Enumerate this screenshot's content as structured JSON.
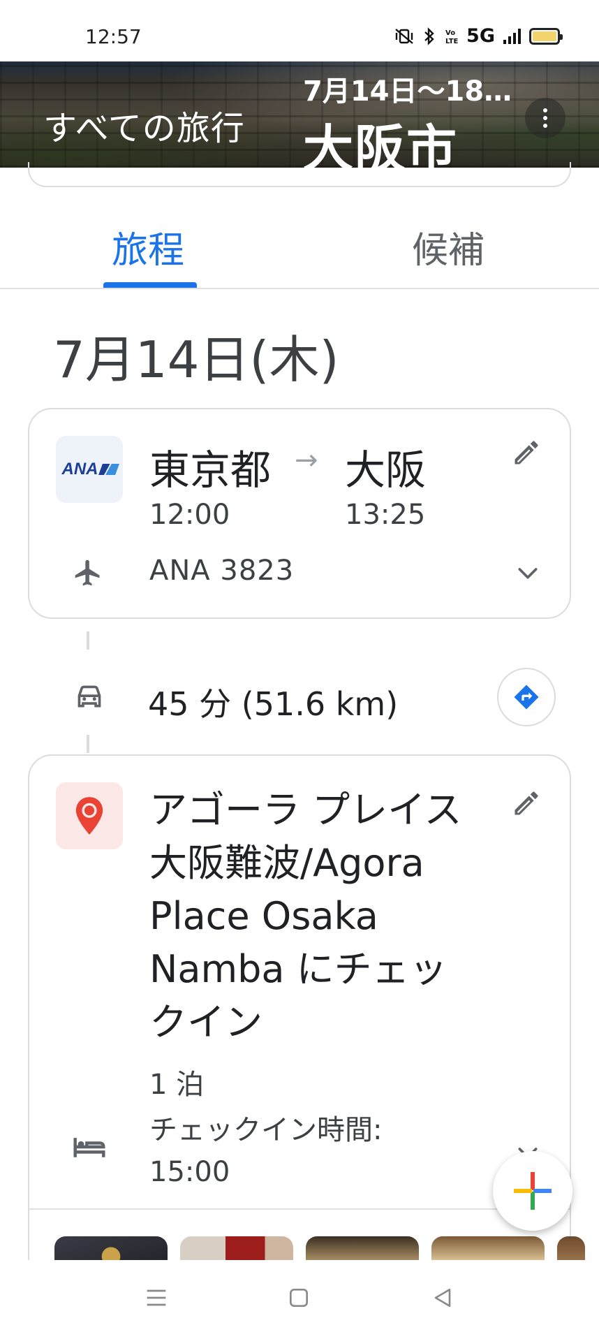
{
  "status_bar": {
    "time": "12:57",
    "network": "5G"
  },
  "header": {
    "back_label": "すべての旅行",
    "dates": "7月14日～18…",
    "city": "大阪市"
  },
  "tabs": [
    {
      "label": "旅程",
      "selected": true
    },
    {
      "label": "候補",
      "selected": false
    }
  ],
  "day": {
    "date": "7月14日(木)"
  },
  "flight": {
    "airline_logo_text": "ANA",
    "from": "東京都",
    "arrow": "→",
    "to": "大阪",
    "departure_time": "12:00",
    "arrival_time": "13:25",
    "flight_number": "ANA 3823"
  },
  "drive": {
    "text": "45 分 (51.6 km)"
  },
  "hotel": {
    "name": "アゴーラ プレイス 大阪難波/Agora Place Osaka Namba にチェックイン",
    "nights": "1 泊",
    "checkin_time_label": "チェックイン時間: 15:00"
  },
  "colors": {
    "accent": "#1a73e8",
    "pin_red": "#ea4335",
    "divider": "#dadce0"
  },
  "icons": {
    "edit": "pencil-icon",
    "flight": "airplane-icon",
    "expand": "chevron-down-icon",
    "car": "car-icon",
    "directions": "directions-icon",
    "hotel": "bed-icon",
    "place": "map-pin-icon",
    "add": "plus-icon"
  }
}
